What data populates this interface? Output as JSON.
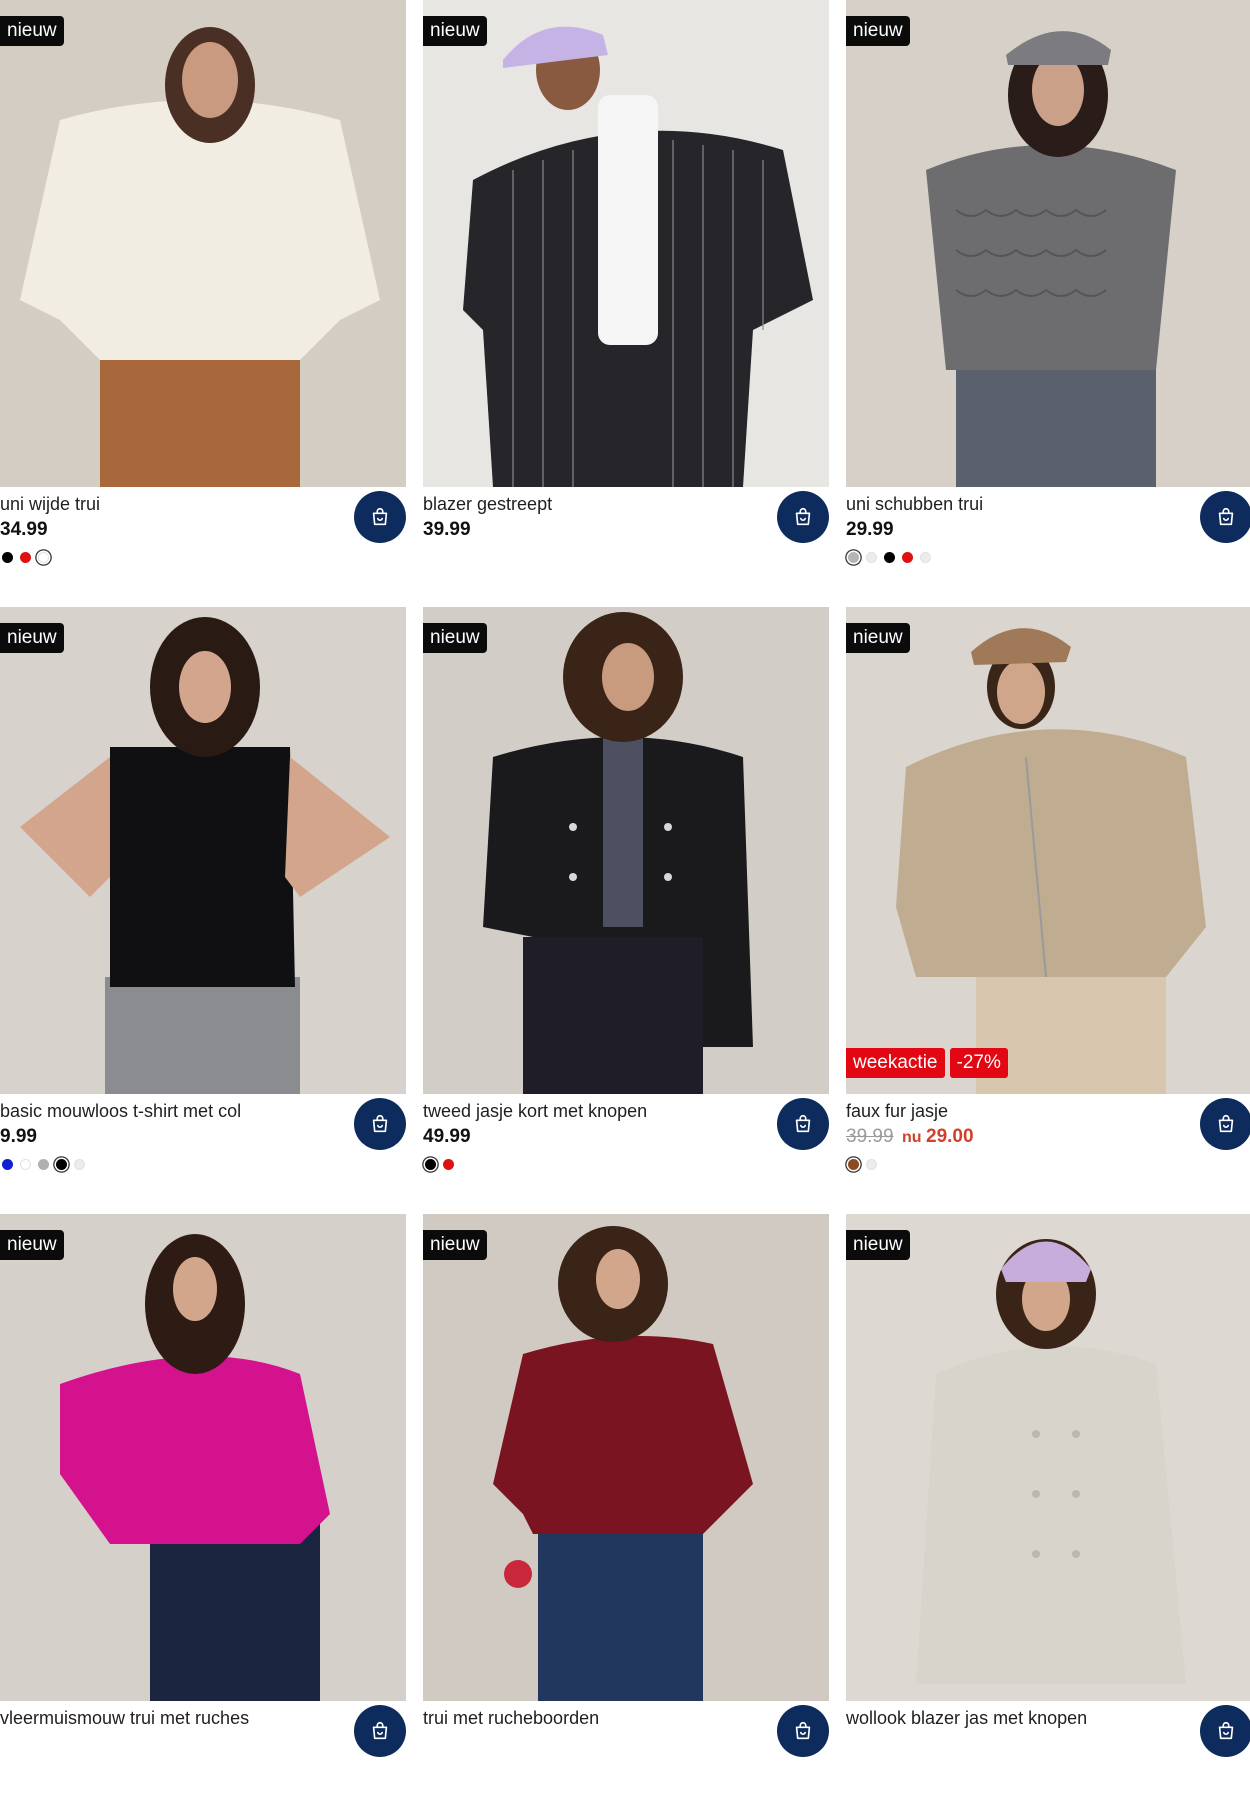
{
  "products": [
    {
      "name": "uni wijde trui",
      "price": "34.99",
      "badge": "nieuw",
      "colors": [
        "#000000",
        "#e01010",
        "#ffffff"
      ],
      "selected": 2
    },
    {
      "name": "blazer gestreept",
      "price": "39.99",
      "badge": "nieuw",
      "colors": [],
      "selected": -1
    },
    {
      "name": "uni schubben trui",
      "price": "29.99",
      "badge": "nieuw",
      "colors": [
        "#b5b5b5",
        "#ececec",
        "#000000",
        "#e01010",
        "#ececec"
      ],
      "selected": 0
    },
    {
      "name": "basic mouwloos t-shirt met col",
      "price": "9.99",
      "badge": "nieuw",
      "colors": [
        "#1020d0",
        "#ffffff",
        "#b0b0b0",
        "#000000",
        "#ececec"
      ],
      "selected": 3
    },
    {
      "name": "tweed jasje kort met knopen",
      "price": "49.99",
      "badge": "nieuw",
      "colors": [
        "#000000",
        "#e01010"
      ],
      "selected": 0
    },
    {
      "name": "faux fur jasje",
      "badge": "nieuw",
      "old_price": "39.99",
      "nu_label": "nu",
      "new_price": "29.00",
      "promo": [
        "weekactie",
        "-27%"
      ],
      "colors": [
        "#8b4a1f",
        "#ececec"
      ],
      "selected": 0
    },
    {
      "name": "vleermuismouw trui met ruches",
      "price": "",
      "badge": "nieuw",
      "colors": [],
      "selected": -1
    },
    {
      "name": "trui met rucheboorden",
      "price": "",
      "badge": "nieuw",
      "colors": [],
      "selected": -1
    },
    {
      "name": "wollook blazer jas met knopen",
      "price": "",
      "badge": "nieuw",
      "colors": [],
      "selected": -1
    }
  ],
  "icons": {
    "cart": "shopping-bag-icon"
  },
  "colors": {
    "cart_button": "#0d2b5c",
    "badge_new": "#0b0b0b",
    "promo": "#e30613",
    "sale_price": "#d0412b"
  }
}
